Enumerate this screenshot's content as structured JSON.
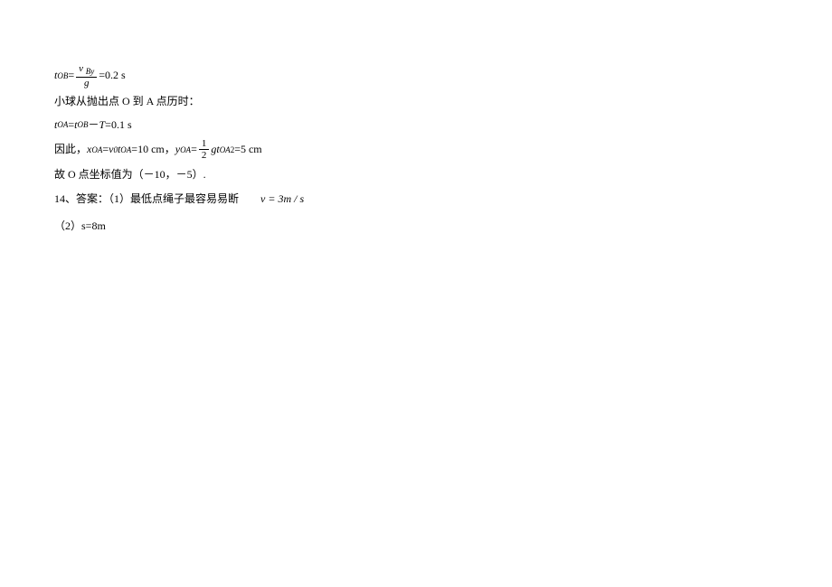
{
  "line1": {
    "t_var": "t",
    "t_sub": "OB",
    "eq": "=",
    "frac_num_v": "v",
    "frac_num_sub": "By",
    "frac_den": "g",
    "result": "=0.2 s"
  },
  "line2": "小球从抛出点 O 到 A 点历时：",
  "line3": {
    "t_var1": "t",
    "t_sub1": "OA",
    "eq1": "=",
    "t_var2": "t",
    "t_sub2": "OB",
    "minus": "－",
    "T": "T",
    "result": "=0.1 s"
  },
  "line4": {
    "prefix": "因此，",
    "x_var": "x",
    "x_sub": "OA",
    "eq1": "=",
    "v_var": "v",
    "v_sub": "0",
    "t_var1": "t",
    "t_sub1": "OA",
    "val1": "=10 cm，",
    "y_var": "y",
    "y_sub": "OA",
    "eq2": "=",
    "frac_num": "1",
    "frac_den": "2",
    "g": "g",
    "t_var2": "t",
    "t_sub2": "OA",
    "sq": "2",
    "val2": "=5 cm"
  },
  "line5": "故 O 点坐标值为（－10，－5）.",
  "line6": {
    "prefix": "14、答案：（1）最低点绳子最容易易断",
    "formula": "v = 3m / s"
  },
  "line7": "（2）s=8m"
}
